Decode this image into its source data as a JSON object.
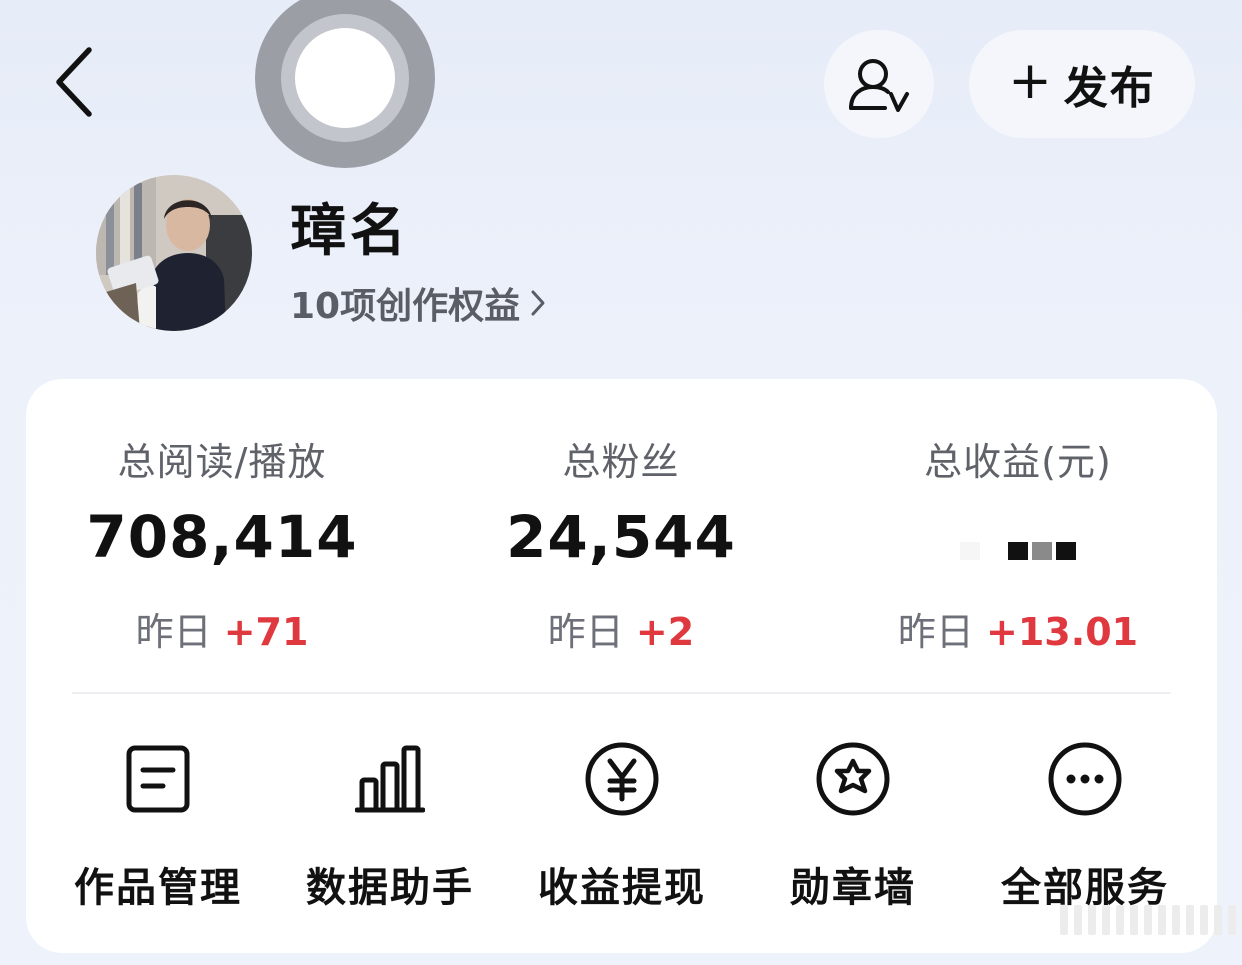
{
  "header": {
    "back_icon": "chevron-left-icon",
    "verify_icon": "user-verified-icon",
    "publish_icon": "plus-icon",
    "publish_plus": "+",
    "publish_label": "发布"
  },
  "profile": {
    "name": "璋名",
    "rights_label": "10项创作权益",
    "rights_arrow": "›"
  },
  "stats": [
    {
      "title": "总阅读/播放",
      "value": "708,414",
      "delta_prefix": "昨日",
      "delta": "+71"
    },
    {
      "title": "总粉丝",
      "value": "24,544",
      "delta_prefix": "昨日",
      "delta": "+2"
    },
    {
      "title": "总收益(元)",
      "value": "",
      "delta_prefix": "昨日",
      "delta": "+13.01"
    }
  ],
  "services": [
    {
      "label": "作品管理",
      "icon": "document-icon"
    },
    {
      "label": "数据助手",
      "icon": "bar-chart-icon"
    },
    {
      "label": "收益提现",
      "icon": "yen-icon"
    },
    {
      "label": "勋章墙",
      "icon": "medal-star-icon"
    },
    {
      "label": "全部服务",
      "icon": "more-icon"
    }
  ],
  "colors": {
    "positive_delta": "#e0383f",
    "background": "#e9eef9",
    "card": "#ffffff"
  }
}
